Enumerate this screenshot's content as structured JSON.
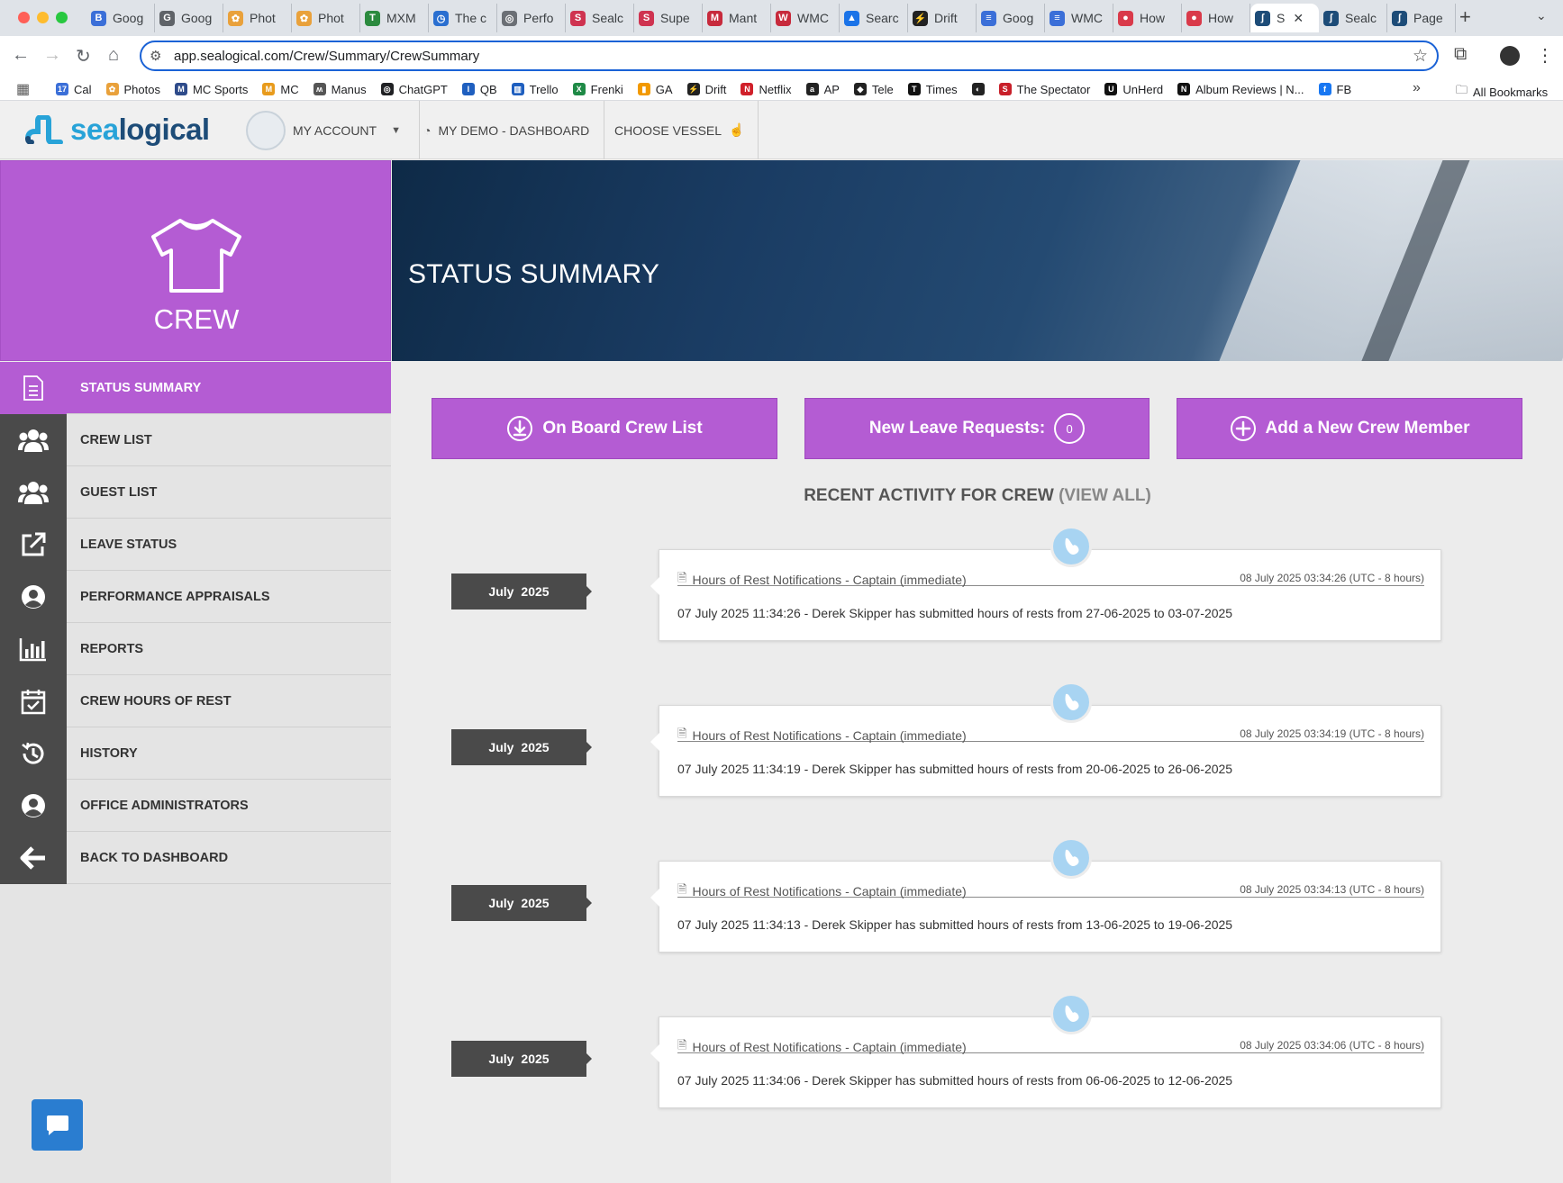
{
  "browser": {
    "tabs": [
      {
        "label": "Goog",
        "color": "#3b6fd8",
        "glyph": "B"
      },
      {
        "label": "Goog",
        "color": "#5f6368",
        "glyph": "G"
      },
      {
        "label": "Phot",
        "color": "#e9a13b",
        "glyph": "✿"
      },
      {
        "label": "Phot",
        "color": "#e9a13b",
        "glyph": "✿"
      },
      {
        "label": "MXM",
        "color": "#2b8a3e",
        "glyph": "T"
      },
      {
        "label": "The c",
        "color": "#2a6fd0",
        "glyph": "◷"
      },
      {
        "label": "Perfo",
        "color": "#6b6f75",
        "glyph": "◎"
      },
      {
        "label": "Sealc",
        "color": "#cf3350",
        "glyph": "S"
      },
      {
        "label": "Supe",
        "color": "#cf3350",
        "glyph": "S"
      },
      {
        "label": "Mant",
        "color": "#c72a3c",
        "glyph": "M"
      },
      {
        "label": "WMC",
        "color": "#c72a3c",
        "glyph": "W"
      },
      {
        "label": "Searc",
        "color": "#1a73e8",
        "glyph": "▲"
      },
      {
        "label": "Drift",
        "color": "#222222",
        "glyph": "⚡"
      },
      {
        "label": "Goog",
        "color": "#3b6fd8",
        "glyph": "≡"
      },
      {
        "label": "WMC",
        "color": "#3b6fd8",
        "glyph": "≡"
      },
      {
        "label": "How",
        "color": "#d93a4a",
        "glyph": "●"
      },
      {
        "label": "How",
        "color": "#d93a4a",
        "glyph": "●"
      },
      {
        "label": "S",
        "color": "#1d4c78",
        "glyph": "ʃ",
        "active": true
      },
      {
        "label": "Sealc",
        "color": "#1d4c78",
        "glyph": "ʃ"
      },
      {
        "label": "Page",
        "color": "#1d4c78",
        "glyph": "ʃ"
      }
    ],
    "url": "app.sealogical.com/Crew/Summary/CrewSummary",
    "bookmarks": [
      {
        "label": "Cal",
        "color": "#3b6fd8",
        "glyph": "17"
      },
      {
        "label": "Photos",
        "color": "#e9a13b",
        "glyph": "✿"
      },
      {
        "label": "MC Sports",
        "color": "#2e4b8a",
        "glyph": "M"
      },
      {
        "label": "MC",
        "color": "#e89b1c",
        "glyph": "M"
      },
      {
        "label": "Manus",
        "color": "#555555",
        "glyph": "ʍ"
      },
      {
        "label": "ChatGPT",
        "color": "#202124",
        "glyph": "◎"
      },
      {
        "label": "QB",
        "color": "#1f5fbf",
        "glyph": "I"
      },
      {
        "label": "Trello",
        "color": "#1f5fbf",
        "glyph": "▥"
      },
      {
        "label": "Frenki",
        "color": "#1f8a46",
        "glyph": "X"
      },
      {
        "label": "GA",
        "color": "#f29900",
        "glyph": "▮"
      },
      {
        "label": "Drift",
        "color": "#222222",
        "glyph": "⚡"
      },
      {
        "label": "Netflix",
        "color": "#d0202a",
        "glyph": "N"
      },
      {
        "label": "AP",
        "color": "#222222",
        "glyph": "a"
      },
      {
        "label": "Tele",
        "color": "#222222",
        "glyph": "◆"
      },
      {
        "label": "Times",
        "color": "#111111",
        "glyph": "T"
      },
      {
        "label": "",
        "color": "#222222",
        "glyph": "◐"
      },
      {
        "label": "The Spectator",
        "color": "#c8202a",
        "glyph": "S"
      },
      {
        "label": "UnHerd",
        "color": "#111111",
        "glyph": "U"
      },
      {
        "label": "Album Reviews | N...",
        "color": "#111111",
        "glyph": "N"
      },
      {
        "label": "FB",
        "color": "#1877f2",
        "glyph": "f"
      }
    ],
    "all_bookmarks": "All Bookmarks"
  },
  "app": {
    "logo_part1": "sea",
    "logo_part2": "logical",
    "account_label": "MY ACCOUNT",
    "dashboard_label": "MY DEMO - DASHBOARD",
    "vessel_label": "CHOOSE VESSEL"
  },
  "sidebar": {
    "section_title": "CREW",
    "items": [
      {
        "label": "STATUS SUMMARY",
        "icon": "document-icon",
        "active": true
      },
      {
        "label": "CREW LIST",
        "icon": "group-icon"
      },
      {
        "label": "GUEST LIST",
        "icon": "group-icon"
      },
      {
        "label": "LEAVE STATUS",
        "icon": "external-link-icon"
      },
      {
        "label": "PERFORMANCE APPRAISALS",
        "icon": "user-circle-icon"
      },
      {
        "label": "REPORTS",
        "icon": "bar-chart-icon"
      },
      {
        "label": "CREW HOURS OF REST",
        "icon": "calendar-check-icon"
      },
      {
        "label": "HISTORY",
        "icon": "history-icon"
      },
      {
        "label": "OFFICE ADMINISTRATORS",
        "icon": "user-circle-icon"
      },
      {
        "label": "BACK TO DASHBOARD",
        "icon": "arrow-left-icon"
      }
    ]
  },
  "main": {
    "banner_title": "STATUS SUMMARY",
    "buttons": {
      "onboard": "On Board Crew List",
      "leave": "New Leave Requests:",
      "leave_count": "0",
      "add": "Add a New Crew Member"
    },
    "recent_title": "RECENT ACTIVITY FOR CREW",
    "view_all": "(VIEW ALL)",
    "activities": [
      {
        "month": "July",
        "year": "2025",
        "title": "Hours of Rest Notifications - Captain (immediate)",
        "timestamp": "08 July 2025 03:34:26  (UTC - 8 hours)",
        "body": "07 July 2025 11:34:26 - Derek Skipper has submitted hours of rests from 27-06-2025 to 03-07-2025"
      },
      {
        "month": "July",
        "year": "2025",
        "title": "Hours of Rest Notifications - Captain (immediate)",
        "timestamp": "08 July 2025 03:34:19  (UTC - 8 hours)",
        "body": "07 July 2025 11:34:19 - Derek Skipper has submitted hours of rests from 20-06-2025 to 26-06-2025"
      },
      {
        "month": "July",
        "year": "2025",
        "title": "Hours of Rest Notifications - Captain (immediate)",
        "timestamp": "08 July 2025 03:34:13  (UTC - 8 hours)",
        "body": "07 July 2025 11:34:13 - Derek Skipper has submitted hours of rests from 13-06-2025 to 19-06-2025"
      },
      {
        "month": "July",
        "year": "2025",
        "title": "Hours of Rest Notifications - Captain (immediate)",
        "timestamp": "08 July 2025 03:34:06  (UTC - 8 hours)",
        "body": "07 July 2025 11:34:06 - Derek Skipper has submitted hours of rests from 06-06-2025 to 12-06-2025"
      }
    ]
  },
  "colors": {
    "accent": "#b45cd3",
    "dark": "#4a4a4a",
    "brand_light": "#28a3d8",
    "brand_dark": "#1d4c78"
  }
}
